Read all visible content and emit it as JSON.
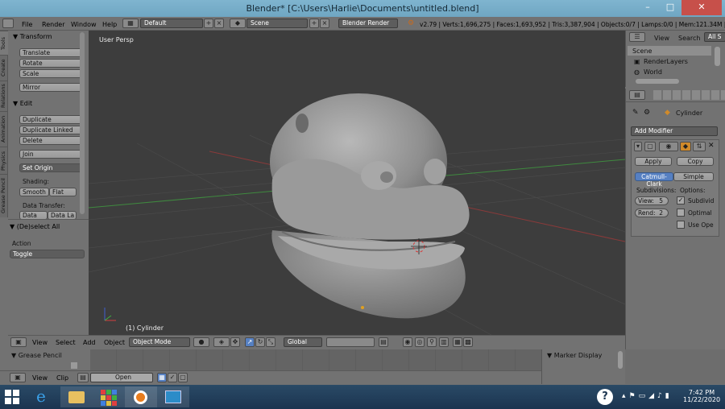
{
  "window": {
    "title": "Blender* [C:\\Users\\Harlie\\Documents\\untitled.blend]",
    "min": "–",
    "max": "□",
    "close": "✕"
  },
  "topbar": {
    "menus": [
      "File",
      "Render",
      "Window",
      "Help"
    ],
    "screen_layout": "Default",
    "scene": "Scene",
    "render_engine": "Blender Render",
    "stats": "v2.79 | Verts:1,696,275 | Faces:1,693,952 | Tris:3,387,904 | Objects:0/7 | Lamps:0/0 | Mem:121.34M | Cyli"
  },
  "tool_tabs": [
    "Tools",
    "Create",
    "Relations",
    "Animation",
    "Physics",
    "Grease Pencil"
  ],
  "toolshelf": {
    "transform_title": "Transform",
    "transform_buttons": [
      "Translate",
      "Rotate",
      "Scale"
    ],
    "mirror": "Mirror",
    "edit_title": "Edit",
    "edit_buttons": [
      "Duplicate",
      "Duplicate Linked",
      "Delete"
    ],
    "join": "Join",
    "set_origin": "Set Origin",
    "shading_label": "Shading:",
    "smooth": "Smooth",
    "flat": "Flat",
    "data_transfer_label": "Data Transfer:",
    "data": "Data",
    "data_layout": "Data La"
  },
  "operator": {
    "title": "(De)select All",
    "action_label": "Action",
    "action_value": "Toggle"
  },
  "viewport": {
    "view_name": "User Persp",
    "object_label": "(1) Cylinder"
  },
  "viewport_header": {
    "menus": [
      "View",
      "Select",
      "Add",
      "Object"
    ],
    "mode": "Object Mode",
    "orientation": "Global"
  },
  "outliner": {
    "view": "View",
    "search": "Search",
    "all": "All S",
    "items": [
      "Scene",
      "RenderLayers",
      "World"
    ]
  },
  "properties": {
    "object_name": "Cylinder",
    "add_modifier": "Add Modifier",
    "apply": "Apply",
    "copy": "Copy",
    "catmull": "Catmull-Clark",
    "simple": "Simple",
    "subdivisions_label": "Subdivisions:",
    "options_label": "Options:",
    "view_label": "View:",
    "view_value": "5",
    "rend_label": "Rend:",
    "rend_value": "2",
    "subdiv_uv": "Subdivid",
    "optimal": "Optimal",
    "use_ope": "Use Ope"
  },
  "timeline": {
    "grease_pencil": "Grease Pencil",
    "marker_display": "Marker Display",
    "menus": [
      "View",
      "Clip"
    ],
    "open": "Open"
  },
  "taskbar": {
    "time": "7:42 PM",
    "date": "11/22/2020",
    "help": "?"
  },
  "colors": {
    "viewport_bg": "#3d3d3d",
    "panel_bg": "#727272",
    "accent_blue": "#5680c2",
    "taskbar": "#1b3450"
  }
}
